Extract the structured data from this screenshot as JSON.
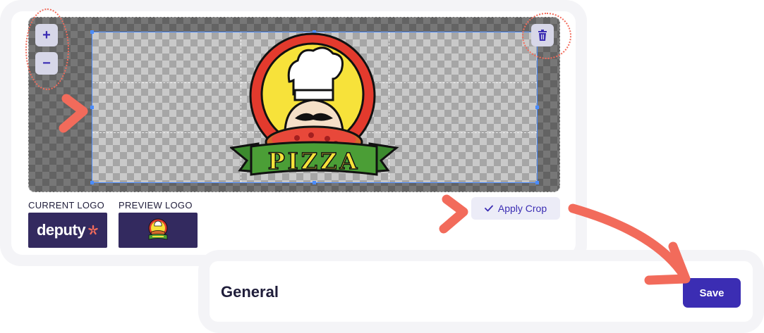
{
  "cropper": {
    "zoom_in_label": "+",
    "zoom_out_label": "−",
    "delete_icon": "trash-icon",
    "current_logo_label": "CURRENT LOGO",
    "preview_logo_label": "PREVIEW LOGO",
    "current_logo_text": "deputy",
    "apply_crop_label": "Apply Crop",
    "apply_crop_icon": "check-icon"
  },
  "pizza_logo": {
    "banner_text": "PIZZA"
  },
  "general": {
    "title": "General",
    "save_label": "Save"
  },
  "colors": {
    "accent": "#3b2db3",
    "annotation": "#f26b5b",
    "logo_background": "#332a5f"
  }
}
